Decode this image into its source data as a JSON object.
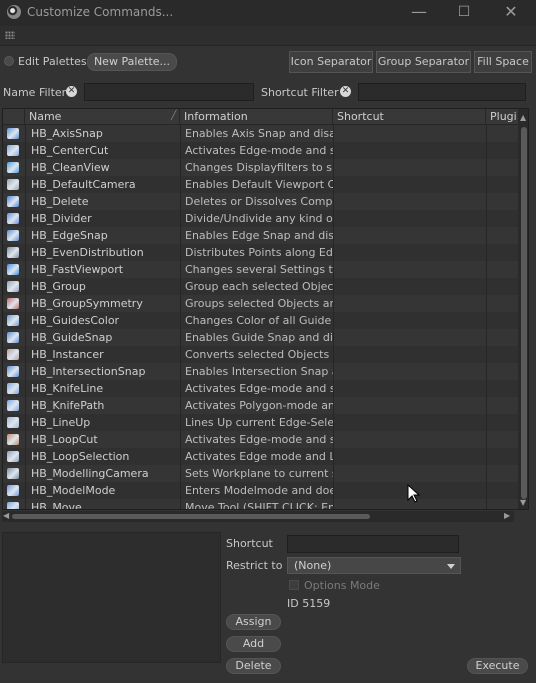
{
  "window": {
    "title": "Customize Commands...",
    "minimize": "—",
    "maximize": "☐",
    "close": "✕"
  },
  "toolbar": {
    "edit_palettes": "Edit Palettes",
    "new_palette": "New Palette...",
    "icon_separator": "Icon Separator",
    "group_separator": "Group Separator",
    "fill_space": "Fill Space"
  },
  "filters": {
    "name_filter_label": "Name Filter",
    "name_filter_value": "",
    "shortcut_filter_label": "Shortcut Filter",
    "shortcut_filter_value": ""
  },
  "table": {
    "columns": [
      "Name",
      "Information",
      "Shortcut",
      "Plugi"
    ],
    "rows": [
      {
        "icon": "axis-snap-icon",
        "color": "#5a8fd6",
        "name": "HB_AxisSnap",
        "info": "Enables Axis Snap and disab",
        "shortcut": ""
      },
      {
        "icon": "center-cut-icon",
        "color": "#7aa7e0",
        "name": "HB_CenterCut",
        "info": "Activates Edge-mode and set",
        "shortcut": ""
      },
      {
        "icon": "clean-view-icon",
        "color": "#4f9ee0",
        "name": "HB_CleanView",
        "info": "Changes Displayfilters to sho",
        "shortcut": ""
      },
      {
        "icon": "default-camera-icon",
        "color": "#9aa3ad",
        "name": "HB_DefaultCamera",
        "info": "Enables Default Viewport Ca",
        "shortcut": ""
      },
      {
        "icon": "delete-icon",
        "color": "#4a86d8",
        "name": "HB_Delete",
        "info": "Deletes or Dissolves Compor",
        "shortcut": ""
      },
      {
        "icon": "divider-icon",
        "color": "#5f8fe0",
        "name": "HB_Divider",
        "info": "Divide/Undivide any kind of",
        "shortcut": ""
      },
      {
        "icon": "edge-snap-icon",
        "color": "#5a8fd6",
        "name": "HB_EdgeSnap",
        "info": "Enables Edge Snap and disal",
        "shortcut": ""
      },
      {
        "icon": "even-distribution-icon",
        "color": "#7d8fa5",
        "name": "HB_EvenDistribution",
        "info": "Distributes Points along Edg",
        "shortcut": ""
      },
      {
        "icon": "fast-viewport-icon",
        "color": "#3d8ee6",
        "name": "HB_FastViewport",
        "info": "Changes several Settings to s",
        "shortcut": ""
      },
      {
        "icon": "group-icon",
        "color": "#8fa4c0",
        "name": "HB_Group",
        "info": "Group each selected Object (",
        "shortcut": ""
      },
      {
        "icon": "group-symmetry-icon",
        "color": "#c06a6a",
        "name": "HB_GroupSymmetry",
        "info": "Groups selected Objects and",
        "shortcut": ""
      },
      {
        "icon": "guides-color-icon",
        "color": "#6f9ad0",
        "name": "HB_GuidesColor",
        "info": "Changes Color of all Guide C",
        "shortcut": ""
      },
      {
        "icon": "guide-snap-icon",
        "color": "#5a8fd6",
        "name": "HB_GuideSnap",
        "info": "Enables Guide Snap and disa",
        "shortcut": ""
      },
      {
        "icon": "instancer-icon",
        "color": "#b9a0a0",
        "name": "HB_Instancer",
        "info": "Converts selected Objects to",
        "shortcut": ""
      },
      {
        "icon": "intersection-snap-icon",
        "color": "#5a8fd6",
        "name": "HB_IntersectionSnap",
        "info": "Enables Intersection Snap ar",
        "shortcut": ""
      },
      {
        "icon": "knife-line-icon",
        "color": "#7aa7e0",
        "name": "HB_KnifeLine",
        "info": "Activates Edge-mode and set",
        "shortcut": ""
      },
      {
        "icon": "knife-path-icon",
        "color": "#7aa7e0",
        "name": "HB_KnifePath",
        "info": "Activates Polygon-mode and",
        "shortcut": ""
      },
      {
        "icon": "line-up-icon",
        "color": "#9fb6d8",
        "name": "HB_LineUp",
        "info": "Lines Up current Edge-Select",
        "shortcut": ""
      },
      {
        "icon": "loop-cut-icon",
        "color": "#c48a6a",
        "name": "HB_LoopCut",
        "info": "Activates Edge-mode and set",
        "shortcut": ""
      },
      {
        "icon": "loop-selection-icon",
        "color": "#8aa0bd",
        "name": "HB_LoopSelection",
        "info": "Activates Edge mode and Loc",
        "shortcut": ""
      },
      {
        "icon": "modelling-camera-icon",
        "color": "#7b8e9e",
        "name": "HB_ModellingCamera",
        "info": "Sets Workplane to current se",
        "shortcut": ""
      },
      {
        "icon": "model-mode-icon",
        "color": "#6d9ad8",
        "name": "HB_ModelMode",
        "info": "Enters Modelmode and does",
        "shortcut": ""
      },
      {
        "icon": "move-icon",
        "color": "#7aa7e0",
        "name": "HB_Move",
        "info": "Move Tool (SHIFT CLICK: Enal",
        "shortcut": ""
      }
    ]
  },
  "details": {
    "shortcut_label": "Shortcut",
    "shortcut_value": "",
    "restrict_label": "Restrict to",
    "restrict_value": "(None)",
    "options_mode": "Options Mode",
    "id_text": "ID 5159",
    "assign": "Assign",
    "add": "Add",
    "delete": "Delete",
    "execute": "Execute"
  }
}
